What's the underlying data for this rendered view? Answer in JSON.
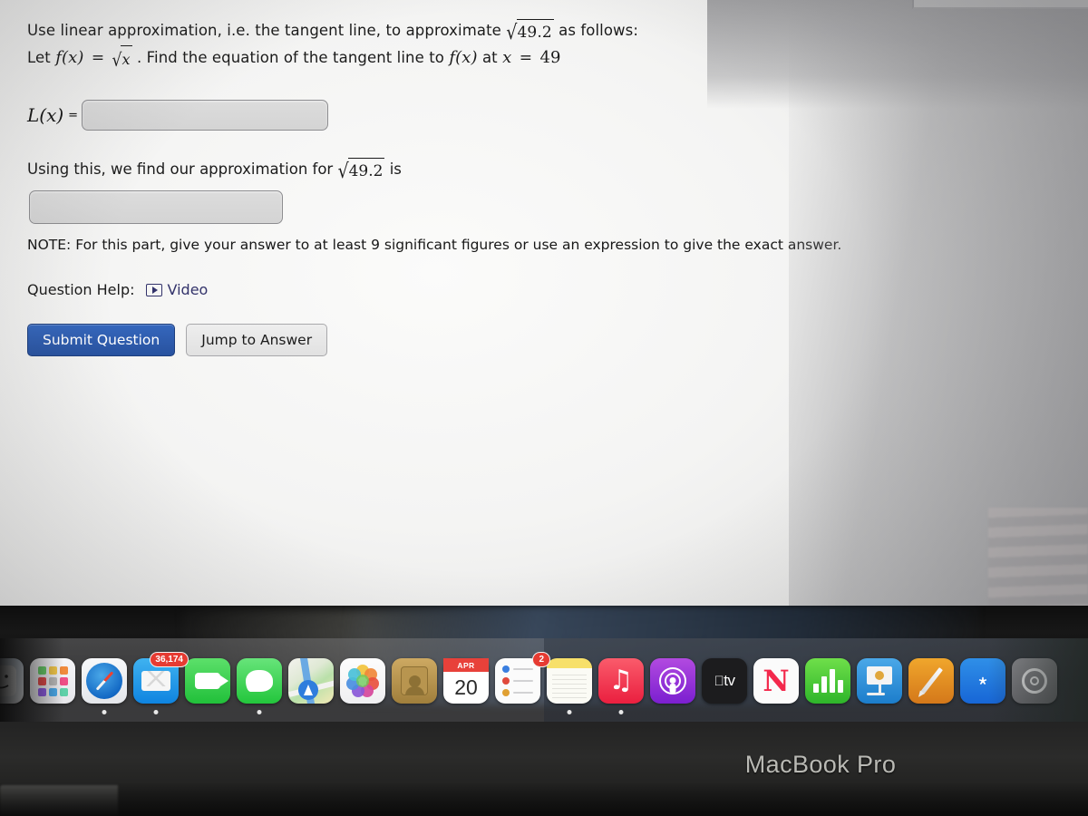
{
  "question": {
    "line1_part1": "Use linear approximation, i.e. the tangent line, to approximate",
    "radical1_sign": "√",
    "radical1_value": "49.2",
    "line1_part2": "as follows:",
    "line2_part1": "Let",
    "line2_fx": "f(x)",
    "line2_equals": "=",
    "line2_sqrt_sign": "√",
    "line2_sqrt_value": "x",
    "line2_part2": ". Find the equation of the tangent line to",
    "line2_fx2": "f(x)",
    "line2_part3": "at",
    "line2_var": "x",
    "line2_eq2": "=",
    "line2_val": "49"
  },
  "lx_row": {
    "label": "L(x)",
    "equals": "=",
    "input_value": "",
    "input_placeholder": ""
  },
  "approximation": {
    "text_before": "Using this, we find our approximation for",
    "radical_sign": "√",
    "radical_value": "49.2",
    "text_after": "is",
    "input_value": "",
    "input_placeholder": ""
  },
  "note": "NOTE: For this part, give your answer to at least 9 significant figures or use an expression to give the exact answer.",
  "help": {
    "label": "Question Help:",
    "video_label": "Video"
  },
  "buttons": {
    "submit": "Submit Question",
    "jump": "Jump to Answer",
    "submit_color": "#2d5fb5"
  },
  "dock": {
    "items": [
      {
        "name": "finder",
        "label": "Finder",
        "badge": null,
        "running": false
      },
      {
        "name": "launchpad",
        "label": "Launchpad",
        "badge": null,
        "running": false
      },
      {
        "name": "safari",
        "label": "Safari",
        "badge": null,
        "running": true
      },
      {
        "name": "mail",
        "label": "Mail",
        "badge": "36,174",
        "running": true
      },
      {
        "name": "facetime",
        "label": "FaceTime",
        "badge": null,
        "running": false
      },
      {
        "name": "messages",
        "label": "Messages",
        "badge": null,
        "running": true
      },
      {
        "name": "maps",
        "label": "Maps",
        "badge": null,
        "running": true
      },
      {
        "name": "photos",
        "label": "Photos",
        "badge": null,
        "running": false
      },
      {
        "name": "contacts",
        "label": "Contacts",
        "badge": null,
        "running": false
      },
      {
        "name": "calendar",
        "label": "Calendar",
        "badge": null,
        "running": false,
        "month": "APR",
        "day": "20"
      },
      {
        "name": "reminders",
        "label": "Reminders",
        "badge": "2",
        "running": false
      },
      {
        "name": "notes",
        "label": "Notes",
        "badge": null,
        "running": true
      },
      {
        "name": "music",
        "label": "Music",
        "badge": null,
        "running": true
      },
      {
        "name": "podcasts",
        "label": "Podcasts",
        "badge": null,
        "running": false
      },
      {
        "name": "appletv",
        "label": "TV",
        "badge": null,
        "running": false,
        "text": "tv"
      },
      {
        "name": "news",
        "label": "News",
        "badge": null,
        "running": false
      },
      {
        "name": "numbers",
        "label": "Numbers",
        "badge": null,
        "running": false
      },
      {
        "name": "keynote",
        "label": "Keynote",
        "badge": null,
        "running": false
      },
      {
        "name": "pages",
        "label": "Pages",
        "badge": null,
        "running": false
      },
      {
        "name": "appstore",
        "label": "App Store",
        "badge": null,
        "running": false
      },
      {
        "name": "syspref",
        "label": "System Preferences",
        "badge": null,
        "running": false
      }
    ]
  },
  "device": {
    "label": "MacBook Pro"
  }
}
